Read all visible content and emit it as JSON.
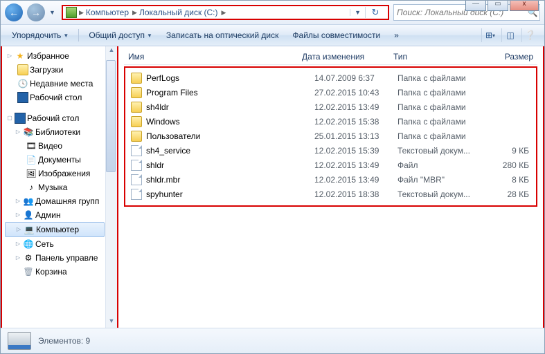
{
  "window_controls": {
    "min": "—",
    "max": "▭",
    "close": "x"
  },
  "nav": {
    "back": "←",
    "forward": "→",
    "crumbs": [
      "Компьютер",
      "Локальный диск (C:)"
    ],
    "refresh": "↻",
    "search_placeholder": "Поиск: Локальный диск (C:)"
  },
  "toolbar": {
    "organize": "Упорядочить",
    "share": "Общий доступ",
    "burn": "Записать на оптический диск",
    "compat": "Файлы совместимости",
    "more": "»"
  },
  "tree": {
    "favorites": "Избранное",
    "fav_items": [
      "Загрузки",
      "Недавние места",
      "Рабочий стол"
    ],
    "desktop": "Рабочий стол",
    "libraries": "Библиотеки",
    "lib_items": [
      "Видео",
      "Документы",
      "Изображения",
      "Музыка"
    ],
    "homegroup": "Домашняя групп",
    "admin": "Админ",
    "computer": "Компьютер",
    "network": "Сеть",
    "control": "Панель управле",
    "trash": "Корзина"
  },
  "columns": {
    "name": "Имя",
    "date": "Дата изменения",
    "type": "Тип",
    "size": "Размер"
  },
  "files": [
    {
      "icon": "folder",
      "name": "PerfLogs",
      "date": "14.07.2009 6:37",
      "type": "Папка с файлами",
      "size": ""
    },
    {
      "icon": "folder",
      "name": "Program Files",
      "date": "27.02.2015 10:43",
      "type": "Папка с файлами",
      "size": ""
    },
    {
      "icon": "folder",
      "name": "sh4ldr",
      "date": "12.02.2015 13:49",
      "type": "Папка с файлами",
      "size": ""
    },
    {
      "icon": "folder",
      "name": "Windows",
      "date": "12.02.2015 15:38",
      "type": "Папка с файлами",
      "size": ""
    },
    {
      "icon": "folder",
      "name": "Пользователи",
      "date": "25.01.2015 13:13",
      "type": "Папка с файлами",
      "size": ""
    },
    {
      "icon": "doc",
      "name": "sh4_service",
      "date": "12.02.2015 15:39",
      "type": "Текстовый докум...",
      "size": "9 КБ"
    },
    {
      "icon": "doc",
      "name": "shldr",
      "date": "12.02.2015 13:49",
      "type": "Файл",
      "size": "280 КБ"
    },
    {
      "icon": "doc",
      "name": "shldr.mbr",
      "date": "12.02.2015 13:49",
      "type": "Файл \"MBR\"",
      "size": "8 КБ"
    },
    {
      "icon": "doc",
      "name": "spyhunter",
      "date": "12.02.2015 18:38",
      "type": "Текстовый докум...",
      "size": "28 КБ"
    }
  ],
  "status": {
    "label": "Элементов: 9"
  }
}
